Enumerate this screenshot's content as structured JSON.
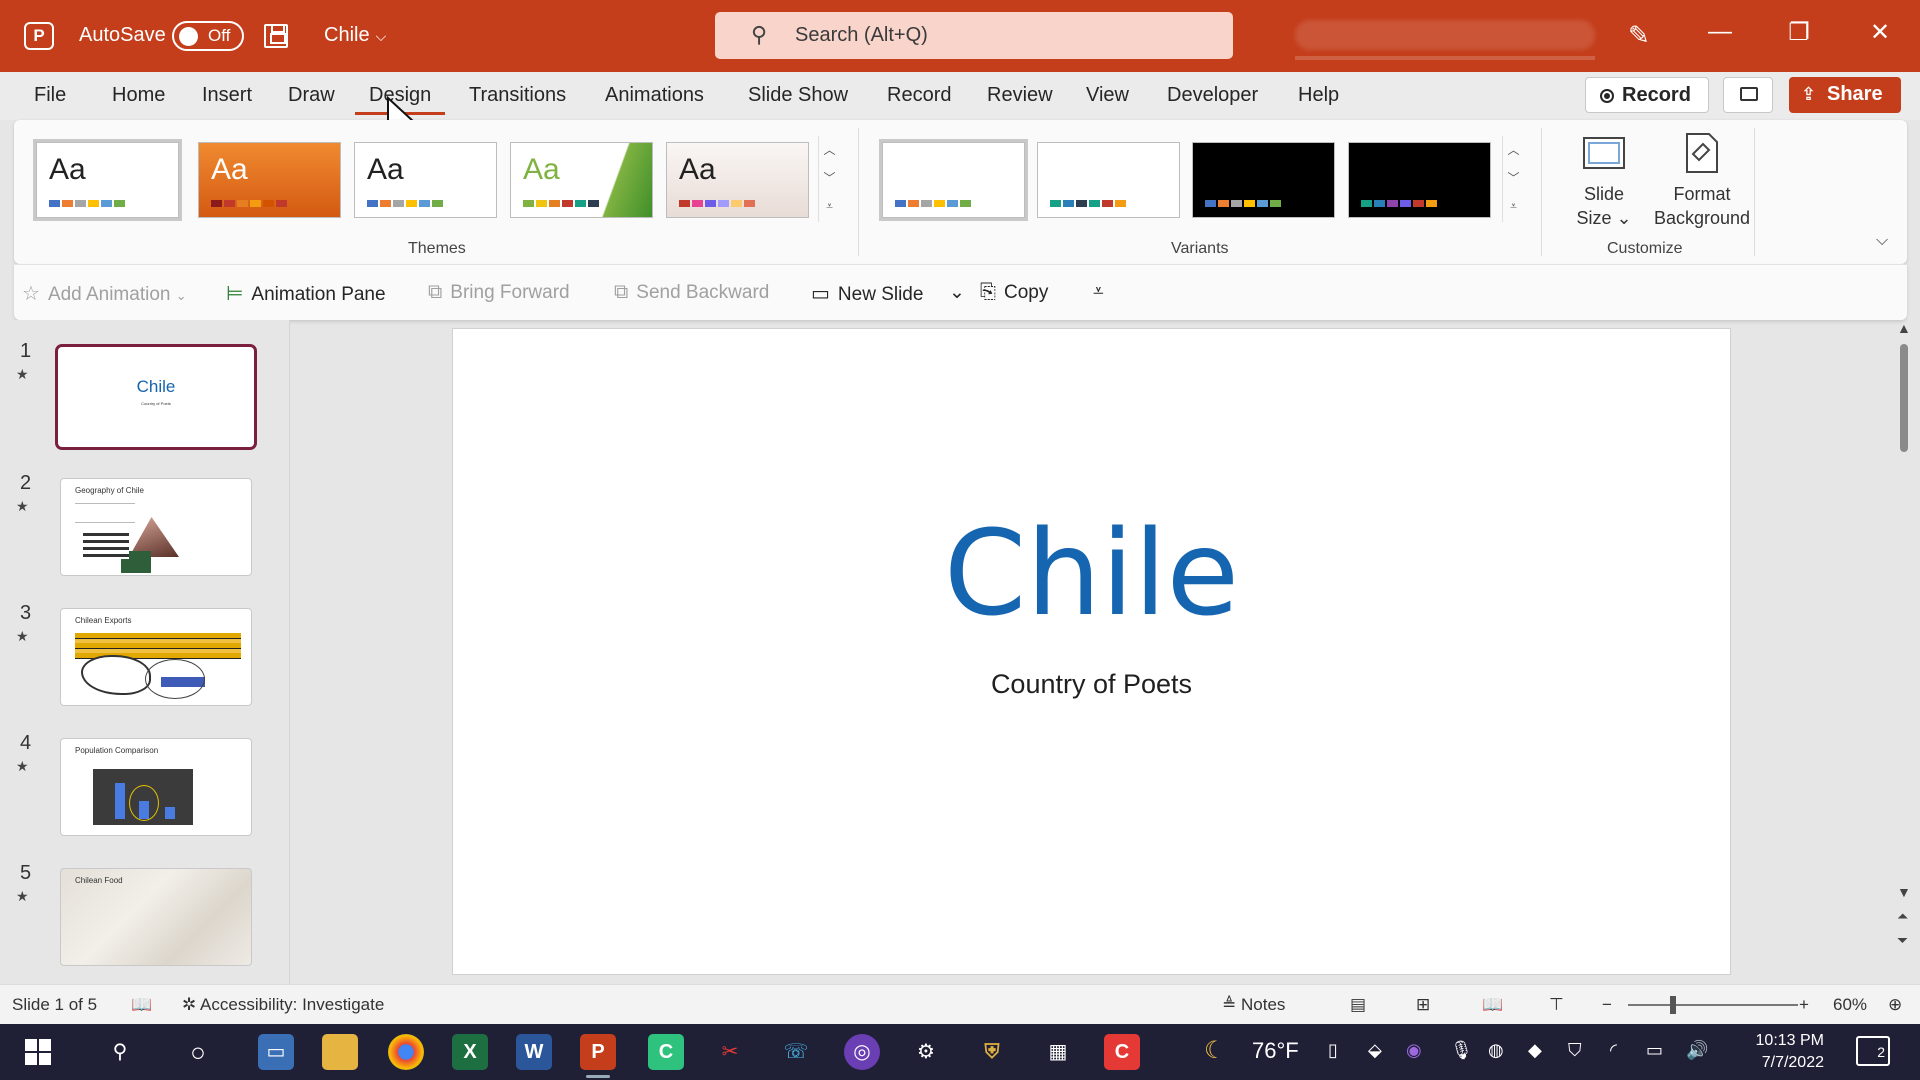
{
  "titlebar": {
    "app_logo": "P",
    "autosave_label": "AutoSave",
    "autosave_state": "Off",
    "doc_title": "Chile",
    "search_placeholder": "Search (Alt+Q)",
    "window_buttons": [
      "—",
      "❐",
      "✕"
    ]
  },
  "menu": {
    "tabs": [
      "File",
      "Home",
      "Insert",
      "Draw",
      "Design",
      "Transitions",
      "Animations",
      "Slide Show",
      "Record",
      "Review",
      "View",
      "Developer",
      "Help"
    ],
    "active_tab": "Design",
    "record_label": "Record",
    "share_label": "Share"
  },
  "ribbon": {
    "themes_label": "Themes",
    "theme_sample": "Aa",
    "variants_label": "Variants",
    "customize_label": "Customize",
    "slide_size_label": [
      "Slide",
      "Size"
    ],
    "format_background_label": [
      "Format",
      "Background"
    ],
    "theme_colors": [
      {
        "bg": "#ffffff",
        "text": "#222222",
        "swatches": [
          "#4472c4",
          "#ed7d31",
          "#a5a5a5",
          "#ffc000",
          "#5b9bd5",
          "#70ad47"
        ]
      },
      {
        "bg": "#e8731f",
        "text": "#ffffff",
        "swatches": [
          "#8b1a1a",
          "#c0392b",
          "#e67e22",
          "#f39c12",
          "#d35400",
          "#c0392b"
        ]
      },
      {
        "bg": "#ffffff",
        "text": "#222222",
        "swatches": [
          "#4472c4",
          "#ed7d31",
          "#a5a5a5",
          "#ffc000",
          "#5b9bd5",
          "#70ad47"
        ]
      },
      {
        "bg": "#ffffff",
        "text": "#7fb241",
        "swatches": [
          "#7fb241",
          "#f1c40f",
          "#e67e22",
          "#c0392b",
          "#16a085",
          "#2c3e50"
        ]
      },
      {
        "bg": "#f2ece9",
        "text": "#222222",
        "swatches": [
          "#c0392b",
          "#e84393",
          "#6c5ce7",
          "#a29bfe",
          "#fdcb6e",
          "#e17055"
        ]
      }
    ],
    "variant_colors": [
      {
        "bg": "#ffffff",
        "swatches": [
          "#4472c4",
          "#ed7d31",
          "#a5a5a5",
          "#ffc000",
          "#5b9bd5",
          "#70ad47"
        ]
      },
      {
        "bg": "#ffffff",
        "swatches": [
          "#16a085",
          "#2980b9",
          "#2c3e50",
          "#16a085",
          "#c0392b",
          "#f39c12"
        ]
      },
      {
        "bg": "#000000",
        "swatches": [
          "#4472c4",
          "#ed7d31",
          "#a5a5a5",
          "#ffc000",
          "#5b9bd5",
          "#70ad47"
        ]
      },
      {
        "bg": "#000000",
        "swatches": [
          "#16a085",
          "#2980b9",
          "#8e44ad",
          "#6c5ce7",
          "#c0392b",
          "#f39c12"
        ]
      }
    ]
  },
  "qat": {
    "add_animation": "Add Animation",
    "animation_pane": "Animation Pane",
    "bring_forward": "Bring Forward",
    "send_backward": "Send Backward",
    "new_slide": "New Slide",
    "copy": "Copy"
  },
  "slides": [
    {
      "num": "1",
      "title": "Chile",
      "subtitle": "Country of Poets"
    },
    {
      "num": "2",
      "title": "Geography of Chile"
    },
    {
      "num": "3",
      "title": "Chilean Exports"
    },
    {
      "num": "4",
      "title": "Population Comparison"
    },
    {
      "num": "5",
      "title": "Chilean Food"
    }
  ],
  "current_slide": {
    "title": "Chile",
    "subtitle": "Country of Poets"
  },
  "status": {
    "slide_counter": "Slide 1 of 5",
    "accessibility": "Accessibility: Investigate",
    "notes": "Notes",
    "zoom": "60%"
  },
  "taskbar": {
    "weather": "76°F",
    "time": "10:13 PM",
    "date": "7/7/2022",
    "notification_count": "2"
  },
  "colors": {
    "accent": "#c43e1c",
    "slide_title": "#1565b0",
    "active_thumb_border": "#7a1f3d"
  }
}
